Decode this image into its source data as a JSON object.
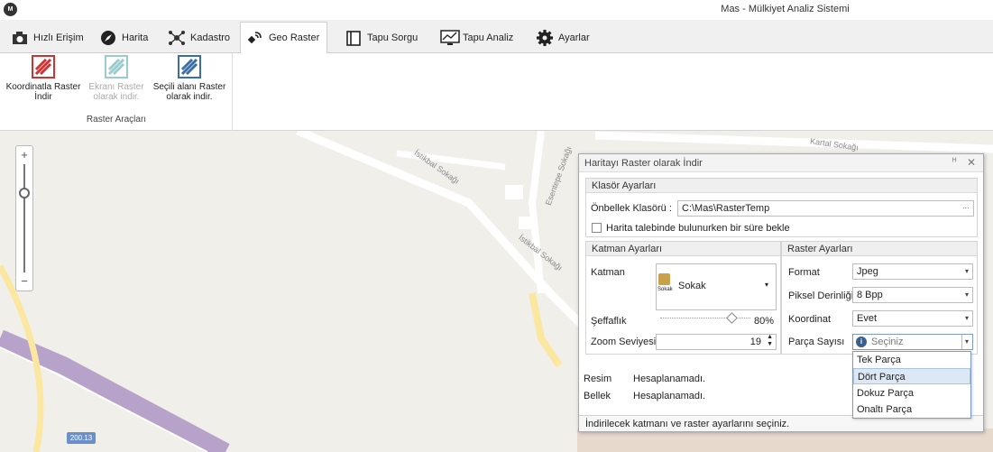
{
  "app": {
    "title": "Mas - Mülkiyet Analiz Sistemi",
    "icon_text": "M"
  },
  "tabs": [
    {
      "label": "Hızlı Erişim",
      "icon": "camera-icon"
    },
    {
      "label": "Harita",
      "icon": "compass-icon"
    },
    {
      "label": "Kadastro",
      "icon": "network-icon"
    },
    {
      "label": "Geo Raster",
      "icon": "satellite-icon",
      "active": true
    },
    {
      "label": "Tapu Sorgu",
      "icon": "book-icon"
    },
    {
      "label": "Tapu Analiz",
      "icon": "chart-monitor-icon"
    },
    {
      "label": "Ayarlar",
      "icon": "gear-icon"
    }
  ],
  "ribbon": {
    "group_label": "Raster Araçları",
    "buttons": [
      {
        "line1": "Koordinatla Raster",
        "line2": "İndir"
      },
      {
        "line1": "Ekranı Raster",
        "line2": "olarak indir."
      },
      {
        "line1": "Seçili alanı Raster",
        "line2": "olarak indir."
      }
    ]
  },
  "map": {
    "streets": [
      "Kartal Sokağı",
      "İstikbal Sokağı",
      "İstikbal Sokağı",
      "Esentepe Sokağı"
    ],
    "route_badge": "200.13",
    "zoom_plus": "+",
    "zoom_minus": "−"
  },
  "dialog": {
    "title": "Haritayı Raster olarak İndir",
    "pin": "ᴴ",
    "close": "✕",
    "folder_panel": {
      "header": "Klasör Ayarları",
      "cache_label": "Önbellek Klasörü :",
      "cache_value": "C:\\Mas\\RasterTemp",
      "browse": "···",
      "wait_label": "Harita talebinde bulunurken bir süre bekle"
    },
    "layer_panel": {
      "header": "Katman Ayarları",
      "layer_label": "Katman",
      "layer_value": "Sokak",
      "layer_sub": "Sokak",
      "opacity_label": "Şeffaflık",
      "opacity_value": "80%",
      "opacity_fraction": 0.8,
      "zoom_label": "Zoom Seviyesi",
      "zoom_value": "19"
    },
    "raster_panel": {
      "header": "Raster Ayarları",
      "format_label": "Format",
      "format_value": "Jpeg",
      "depth_label": "Piksel Derinliği",
      "depth_value": "8 Bpp",
      "coord_label": "Koordinat",
      "coord_value": "Evet",
      "parts_label": "Parça Sayısı",
      "parts_placeholder": "Seçiniz"
    },
    "info": {
      "image_label": "Resim",
      "image_value": "Hesaplanamadı.",
      "memory_label": "Bellek",
      "memory_value": "Hesaplanamadı."
    },
    "status": "İndirilecek katmanı ve raster ayarlarını seçiniz."
  },
  "parts_options": [
    "Tek Parça",
    "Dört Parça",
    "Dokuz Parça",
    "Onaltı Parça"
  ],
  "highlighted_option": "Dört Parça",
  "colors": {
    "accent": "#3a6ea5",
    "map_bg": "#f1efea",
    "road": "#fbe7a0"
  }
}
